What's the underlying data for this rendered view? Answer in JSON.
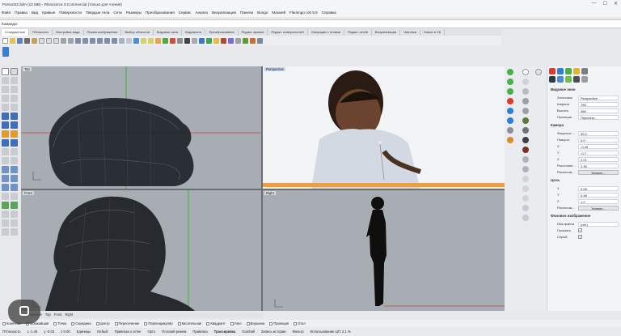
{
  "window": {
    "title": "Person03.3dm (10 MB) - Rhinoceros 6 Commercial (только для чтения)",
    "controls": [
      "—",
      "☐",
      "✕"
    ]
  },
  "menu": [
    "Файл",
    "Правка",
    "Вид",
    "Кривые",
    "Поверхности",
    "Твердые тела",
    "Сети",
    "Размеры",
    "Преобразования",
    "Сервис",
    "Анализ",
    "Визуализация",
    "Панели",
    "Bongo",
    "Maxwell",
    "Flamingo nXt 5.5",
    "Справка"
  ],
  "command": {
    "label": "Команда:",
    "value": ""
  },
  "toolbar_tabs": [
    "Стандартные",
    "ПЛоскости",
    "Настройка вида",
    "Режим изображения",
    "Выбор объектов",
    "Видовые окна",
    "Видимость",
    "Преобразования",
    "Редакт. кривых",
    "Редакт. поверхностей",
    "Операции с телами",
    "Редакт. сетей",
    "Визуализация",
    "Чертежи",
    "Новое в V6"
  ],
  "viewports": {
    "top": {
      "label": "Top"
    },
    "perspective": {
      "label": "Perspective"
    },
    "front": {
      "label": "Front"
    },
    "right": {
      "label": "Right"
    }
  },
  "properties": {
    "section_viewport": "Видовое окно",
    "rows_viewport": [
      {
        "k": "Заголовок",
        "v": "Perspective"
      },
      {
        "k": "Ширина",
        "v": "756"
      },
      {
        "k": "Высота",
        "v": "386"
      },
      {
        "k": "Проекция",
        "v": "Перспект..."
      }
    ],
    "section_camera": "Камера",
    "rows_camera": [
      {
        "k": "Фокусное ...",
        "v": "50.0"
      },
      {
        "k": "Поворот",
        "v": "0.0"
      },
      {
        "k": "X",
        "v": "-0.49"
      },
      {
        "k": "Y",
        "v": "-0.7"
      },
      {
        "k": "Z",
        "v": "2.01"
      },
      {
        "k": "Расстояни...",
        "v": "1.35"
      }
    ],
    "camera_place": {
      "k": "Располож...",
      "btn": "Указать..."
    },
    "section_target": "Цель",
    "rows_target": [
      {
        "k": "X",
        "v": "0.06"
      },
      {
        "k": "Y",
        "v": "0.28"
      },
      {
        "k": "Z",
        "v": "1.2"
      }
    ],
    "target_place": {
      "k": "Располож...",
      "btn": "Указать..."
    },
    "section_background": "Фоновое изображение",
    "bg_file": {
      "k": "Имя файла",
      "v": "(нет)"
    },
    "bg_show": {
      "k": "Показать",
      "v": "✓"
    },
    "bg_gray": {
      "k": "Серый",
      "v": "✓"
    }
  },
  "bottom_tabs": [
    "Perspective",
    "Top",
    "Front",
    "Right"
  ],
  "snaps": [
    "Конечная",
    "Ближайшая",
    "Точка",
    "Середина",
    "Центр",
    "Пересечение",
    "Перпендикуляр",
    "Касательная",
    "Квадрант",
    "Узел",
    "Вершина",
    "Проекция",
    "Откл"
  ],
  "status": {
    "cplane": "ГПлоскость",
    "x": "x -1.46",
    "y": "y -0.03",
    "z": "z 0.00",
    "units": "Единицы",
    "layer": "Default",
    "grid": "Привязка к сетке",
    "ortho": "Орто",
    "planar": "Плоский режим",
    "osnap": "Привязка",
    "smarttrack": "Трассировка",
    "gumball": "Gumball",
    "history": "Запись истории",
    "filter": "Фильтр",
    "cpu": "Использование ЦП: 2.1 %"
  },
  "colors": {
    "accent": "#3a7bd5",
    "grid_red": "#c8413b",
    "grid_green": "#3cae3f",
    "strip": "#f39c3b"
  }
}
